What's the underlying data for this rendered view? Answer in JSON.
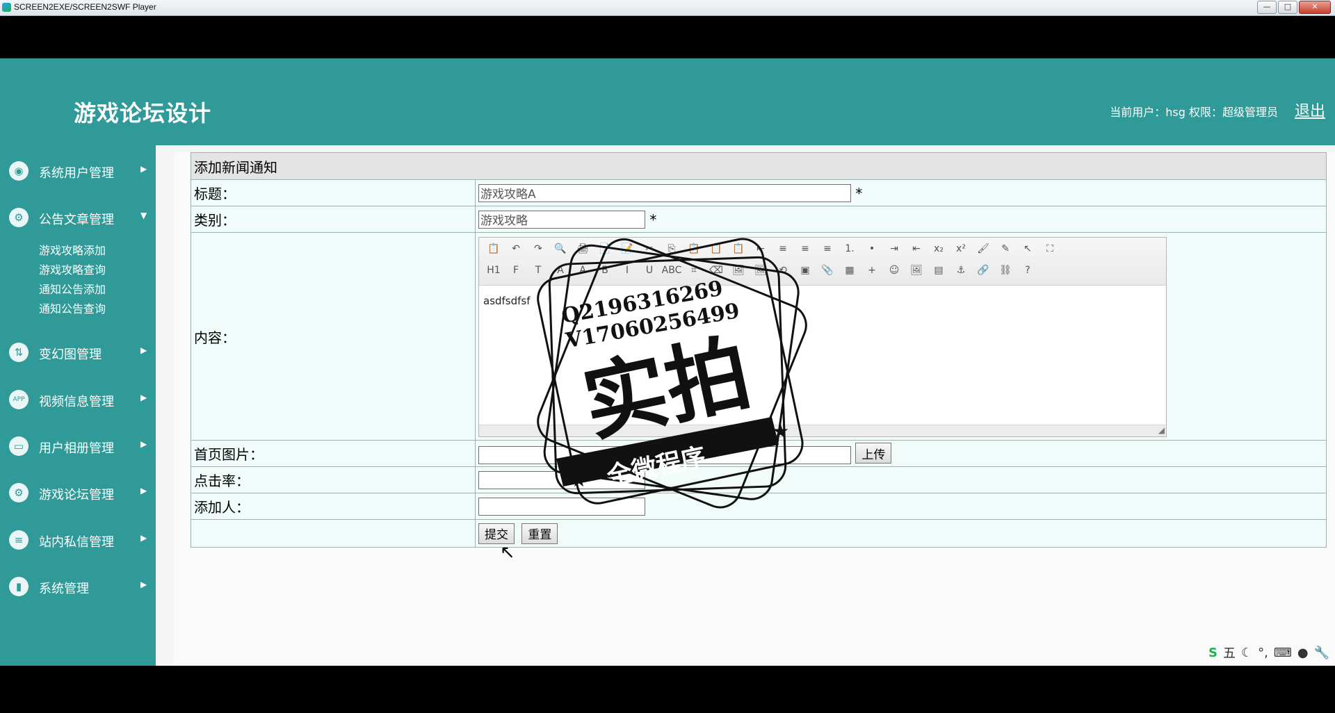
{
  "window": {
    "title": "SCREEN2EXE/SCREEN2SWF Player",
    "buttons": [
      "—",
      "□",
      "✕"
    ]
  },
  "app": {
    "title": "游戏论坛设计",
    "user_info": "当前用户：hsg  权限：超级管理员",
    "logout": "退出"
  },
  "sidebar": {
    "items": [
      {
        "label": "系统用户管理",
        "icon": "user-screen-icon",
        "glyph": "◉",
        "arrow": "▶"
      },
      {
        "label": "公告文章管理",
        "icon": "user-gear-icon",
        "glyph": "⚙",
        "arrow": "▼"
      },
      {
        "label": "变幻图管理",
        "icon": "swap-icon",
        "glyph": "⇅",
        "arrow": "▶"
      },
      {
        "label": "视频信息管理",
        "icon": "app-icon",
        "glyph": "APP",
        "arrow": "▶"
      },
      {
        "label": "用户相册管理",
        "icon": "car-icon",
        "glyph": "▭",
        "arrow": "▶"
      },
      {
        "label": "游戏论坛管理",
        "icon": "gear-icon",
        "glyph": "⚙",
        "arrow": "▶"
      },
      {
        "label": "站内私信管理",
        "icon": "stack-icon",
        "glyph": "≡",
        "arrow": "▶"
      },
      {
        "label": "系统管理",
        "icon": "bar-chart-icon",
        "glyph": "▮",
        "arrow": "▶"
      }
    ],
    "sub_items": [
      "游戏攻略添加",
      "游戏攻略查询",
      "通知公告添加",
      "通知公告查询"
    ]
  },
  "form": {
    "heading": "添加新闻通知",
    "title_label": "标题：",
    "title_value": "游戏攻略A",
    "category_label": "类别：",
    "category_value": "游戏攻略",
    "required_mark": "*",
    "content_label": "内容：",
    "content_value": "asdfsdfsf",
    "image_label": "首页图片：",
    "upload_button": "上传",
    "clicks_label": "点击率：",
    "adder_label": "添加人：",
    "submit_button": "提交",
    "reset_button": "重置"
  },
  "editor": {
    "row1": [
      "📋",
      "↶",
      "↷",
      "🔍",
      "🖨",
      "📄",
      "📝",
      "✂",
      "⎘",
      "📋",
      "📋",
      "📋",
      "⇤",
      "≡",
      "≡",
      "≡",
      "1.",
      "•",
      "⇥",
      "⇤",
      "x₂",
      "x²",
      "🖌",
      "✎",
      "↖",
      "⛶"
    ],
    "row2": [
      "H1",
      "F",
      "T",
      "A",
      "A",
      "B",
      "I",
      "U",
      "ABC",
      "⌗",
      "⌫",
      "🖼",
      "🖼",
      "⟲",
      "▣",
      "📎",
      "▦",
      "+",
      "☺",
      "🖼",
      "▤",
      "⚓",
      "🔗",
      "⛓",
      "?"
    ]
  },
  "watermark": {
    "qq": "Q2196316269",
    "vx": "V17060256499",
    "main": "实拍",
    "sub": "全微程序"
  },
  "ime": {
    "items": [
      "S",
      "五",
      "☾",
      "°,",
      "⌨",
      "●",
      "🔧"
    ]
  }
}
